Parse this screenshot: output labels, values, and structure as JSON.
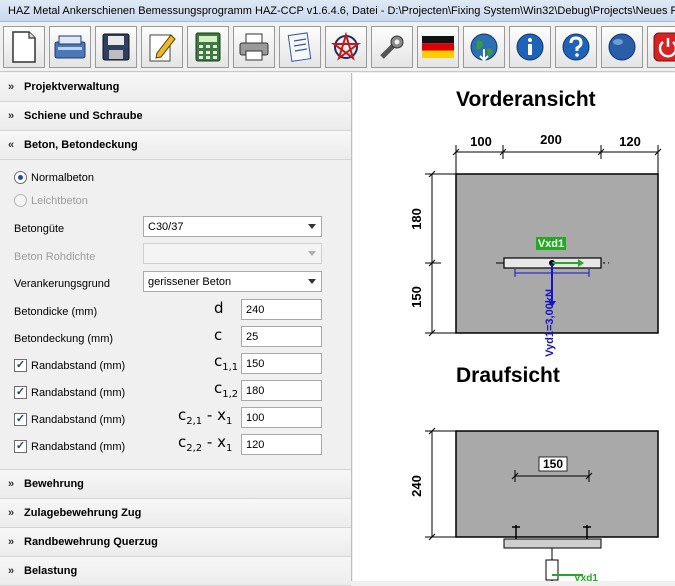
{
  "window": {
    "title": "HAZ Metal Ankerschienen Bemessungsprogramm HAZ-CCP v1.6.4.6, Datei - D:\\Projecten\\Fixing System\\Win32\\Debug\\Projects\\Neues Projekt.mdb - P"
  },
  "toolbar": {
    "buttons": [
      {
        "name": "new-document-icon"
      },
      {
        "name": "scanner-icon"
      },
      {
        "name": "save-disk-icon"
      },
      {
        "name": "edit-pencil-icon"
      },
      {
        "name": "calculator-icon"
      },
      {
        "name": "printer-icon"
      },
      {
        "name": "report-icon"
      },
      {
        "name": "pentagram-icon"
      },
      {
        "name": "tools-wrench-icon"
      },
      {
        "name": "german-flag-icon"
      },
      {
        "name": "globe-download-icon"
      },
      {
        "name": "info-icon"
      },
      {
        "name": "help-icon"
      },
      {
        "name": "globe-icon"
      },
      {
        "name": "power-icon"
      }
    ]
  },
  "sections": {
    "projektverwaltung": "Projektverwaltung",
    "schiene": "Schiene und Schraube",
    "beton": "Beton, Betondeckung",
    "bewehrung": "Bewehrung",
    "zulage": "Zulagebewehrung Zug",
    "randbewehrung": "Randbewehrung Querzug",
    "belastung": "Belastung"
  },
  "beton": {
    "normalbeton": "Normalbeton",
    "leichtbeton": "Leichtbeton",
    "betonguete_label": "Betongüte",
    "betonguete_value": "C30/37",
    "rohdichte_label": "Beton Rohdichte",
    "rohdichte_value": "",
    "verankerungsgrund_label": "Verankerungsgrund",
    "verankerungsgrund_value": "gerissener Beton",
    "betondicke_label": "Betondicke (mm)",
    "betondicke_sym": "d",
    "betondicke_value": "240",
    "betondeckung_label": "Betondeckung (mm)",
    "betondeckung_sym": "c",
    "betondeckung_value": "25",
    "rand_label": "Randabstand (mm)",
    "rand1_value": "150",
    "rand2_value": "180",
    "rand3_value": "100",
    "rand4_value": "120",
    "check_mark": "✓"
  },
  "drawing": {
    "front_title": "Vorderansicht",
    "top_title": "Draufsicht",
    "dim_100": "100",
    "dim_200": "200",
    "dim_120": "120",
    "dim_180": "180",
    "dim_150": "150",
    "dim_240": "240",
    "dim_150_top": "150",
    "load_label": "Vxd1",
    "load_value": "Vyd1=3,00kN",
    "load_label_bottom": "Vxd1"
  }
}
